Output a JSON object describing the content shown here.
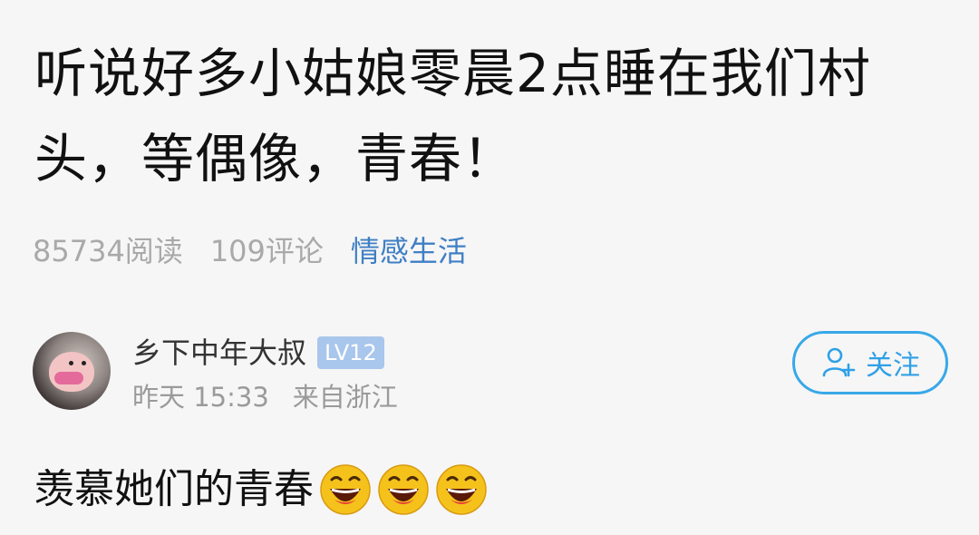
{
  "post": {
    "title": "听说好多小姑娘零晨2点睡在我们村头，等偶像，青春！",
    "reads": "85734阅读",
    "comments": "109评论",
    "category": "情感生活"
  },
  "author": {
    "name": "乡下中年大叔",
    "level": "LV12",
    "date": "昨天 15:33",
    "location": "来自浙江",
    "follow_label": "关注",
    "avatar_icon": "pig-avatar"
  },
  "comment": {
    "text": "羡慕她们的青春",
    "emojis": [
      "laughing-emoji",
      "laughing-emoji",
      "laughing-emoji"
    ]
  },
  "colors": {
    "category": "#3f7fc4",
    "follow": "#2fa0e6",
    "badge": "#a9c6ec",
    "meta": "#a9a9a9"
  }
}
